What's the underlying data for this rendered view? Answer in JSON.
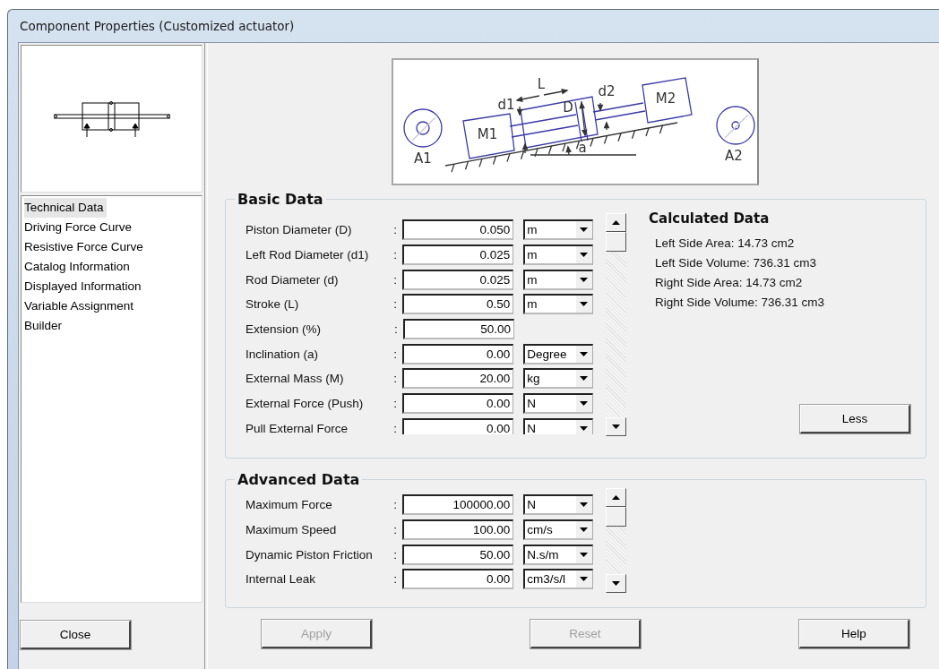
{
  "window": {
    "title": "Component Properties (Customized actuator)"
  },
  "nav": {
    "items": [
      {
        "label": "Technical Data",
        "selected": true
      },
      {
        "label": "Driving Force Curve",
        "selected": false
      },
      {
        "label": "Resistive Force Curve",
        "selected": false
      },
      {
        "label": "Catalog Information",
        "selected": false
      },
      {
        "label": "Displayed Information",
        "selected": false
      },
      {
        "label": "Variable Assignment",
        "selected": false
      },
      {
        "label": "Builder",
        "selected": false
      }
    ]
  },
  "close_button": {
    "label": "Close"
  },
  "diagram": {
    "labels": [
      "L",
      "d1",
      "D",
      "d2",
      "M1",
      "M2",
      "a",
      "A1",
      "A2"
    ]
  },
  "basic_data": {
    "title": "Basic Data",
    "rows": [
      {
        "label": "Piston Diameter (D)",
        "colon": ":",
        "value": "0.050",
        "unit": "m"
      },
      {
        "label": "Left Rod Diameter (d1)",
        "colon": ":",
        "value": "0.025",
        "unit": "m"
      },
      {
        "label": "Rod Diameter (d)",
        "colon": ":",
        "value": "0.025",
        "unit": "m"
      },
      {
        "label": "Stroke (L)",
        "colon": ":",
        "value": "0.50",
        "unit": "m"
      },
      {
        "label": "Extension (%)",
        "colon": ":",
        "value": "50.00"
      },
      {
        "label": "Inclination (a)",
        "colon": ":",
        "value": "0.00",
        "unit": "Degree"
      },
      {
        "label": "External Mass (M)",
        "colon": ":",
        "value": "20.00",
        "unit": "kg"
      },
      {
        "label": "External Force (Push)",
        "colon": ":",
        "value": "0.00",
        "unit": "N"
      },
      {
        "label": "Pull External Force",
        "colon": ":",
        "value": "0.00",
        "unit": "N"
      }
    ],
    "calculated": {
      "title": "Calculated Data",
      "lines": [
        "Left Side Area: 14.73 cm2",
        "Left Side Volume: 736.31 cm3",
        "Right Side Area: 14.73 cm2",
        "Right Side Volume: 736.31 cm3"
      ]
    },
    "less_button": {
      "label": "Less"
    }
  },
  "advanced_data": {
    "title": "Advanced Data",
    "rows": [
      {
        "label": "Maximum Force",
        "colon": ":",
        "value": "100000.00",
        "unit": "N"
      },
      {
        "label": "Maximum Speed",
        "colon": ":",
        "value": "100.00",
        "unit": "cm/s"
      },
      {
        "label": "Dynamic Piston Friction",
        "colon": ":",
        "value": "50.00",
        "unit": "N.s/m"
      },
      {
        "label": "Internal Leak",
        "colon": ":",
        "value": "0.00",
        "unit": "cm3/s/l"
      }
    ]
  },
  "buttons": [
    {
      "label": "Apply",
      "disabled": true
    },
    {
      "label": "Reset",
      "disabled": true
    },
    {
      "label": "Help",
      "disabled": false
    }
  ]
}
